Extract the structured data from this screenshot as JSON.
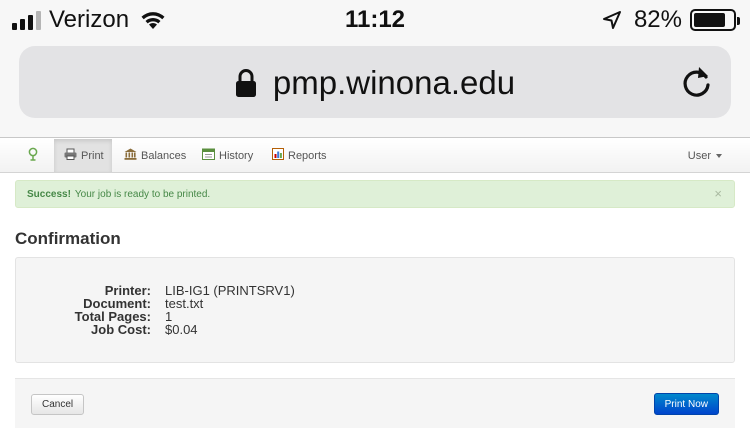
{
  "status_bar": {
    "carrier": "Verizon",
    "time": "11:12",
    "battery_percent": "82%",
    "battery_level": 0.82,
    "signal_bars": 4,
    "signal_bars_active": 3
  },
  "browser": {
    "url": "pmp.winona.edu"
  },
  "nav": {
    "items": [
      {
        "label": "Print",
        "icon": "printer-icon",
        "active": true
      },
      {
        "label": "Balances",
        "icon": "bank-icon"
      },
      {
        "label": "History",
        "icon": "calendar-icon"
      },
      {
        "label": "Reports",
        "icon": "report-icon"
      }
    ],
    "user_label": "User"
  },
  "alert": {
    "strong": "Success!",
    "message": "Your job is ready to be printed.",
    "close": "×"
  },
  "heading": "Confirmation",
  "details": [
    {
      "label": "Printer:",
      "value": "LIB-IG1 (PRINTSRV1)"
    },
    {
      "label": "Document:",
      "value": "test.txt"
    },
    {
      "label": "Total Pages:",
      "value": "1"
    },
    {
      "label": "Job Cost:",
      "value": "$0.04"
    }
  ],
  "actions": {
    "cancel_label": "Cancel",
    "print_label": "Print Now"
  },
  "colors": {
    "alert_bg": "#dff0d8",
    "alert_text": "#468847",
    "primary_button": "#0055cc"
  }
}
